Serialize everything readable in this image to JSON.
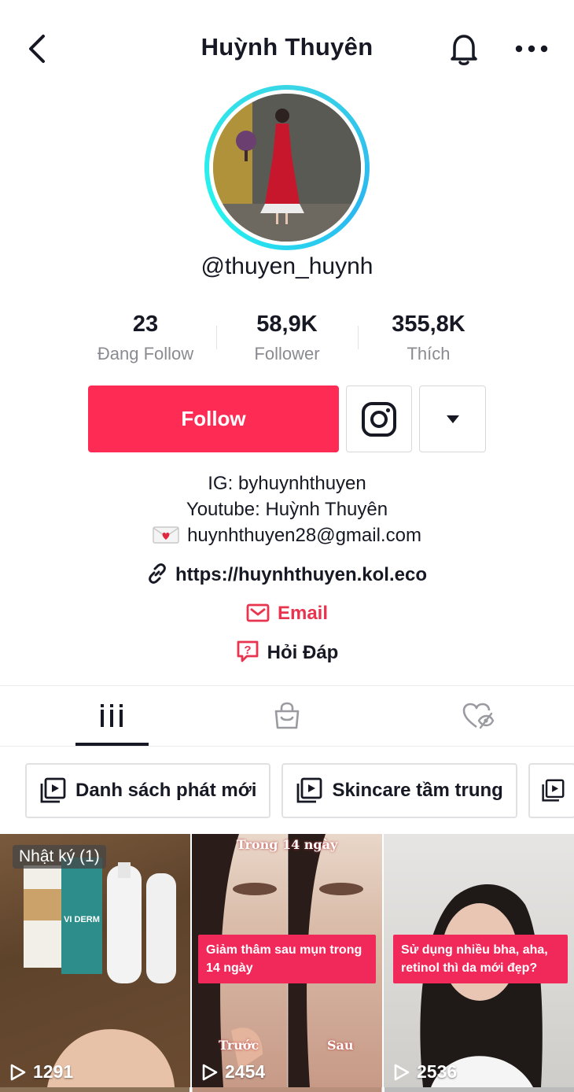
{
  "header": {
    "title": "Huỳnh Thuyên"
  },
  "profile": {
    "handle": "@thuyen_huynh",
    "avatar_icon": "profile-photo"
  },
  "stats": [
    {
      "value": "23",
      "label": "Đang Follow"
    },
    {
      "value": "58,9K",
      "label": "Follower"
    },
    {
      "value": "355,8K",
      "label": "Thích"
    }
  ],
  "actions": {
    "follow_label": "Follow",
    "accent_color": "#fe2c55"
  },
  "bio": {
    "line1": "IG: byhuynhthuyen",
    "line2": "Youtube: Huỳnh Thuyên",
    "line3": "huynhthuyen28@gmail.com",
    "link": "https://huynhthuyen.kol.eco",
    "email_label": "Email",
    "qa_label": "Hỏi Đáp"
  },
  "tabs": [
    {
      "name": "videos",
      "icon": "grid-icon",
      "active": true
    },
    {
      "name": "shop",
      "icon": "shopping-bag-icon",
      "active": false
    },
    {
      "name": "liked",
      "icon": "hidden-heart-icon",
      "active": false
    }
  ],
  "playlists": [
    {
      "label": "Danh sách phát mới"
    },
    {
      "label": "Skincare tầm trung"
    }
  ],
  "videos": [
    {
      "badge": "Nhật ký (1)",
      "views": "1291"
    },
    {
      "caption_top": "Trong 14 ngày",
      "caption": "Giảm thâm sau mụn trong 14 ngày",
      "before": "Trước",
      "after": "Sau",
      "views": "2454"
    },
    {
      "caption": "Sử dụng nhiều bha, aha, retinol thì da mới đẹp?",
      "views": "2536"
    }
  ],
  "product_labels": {
    "brand": "VI DERM"
  }
}
